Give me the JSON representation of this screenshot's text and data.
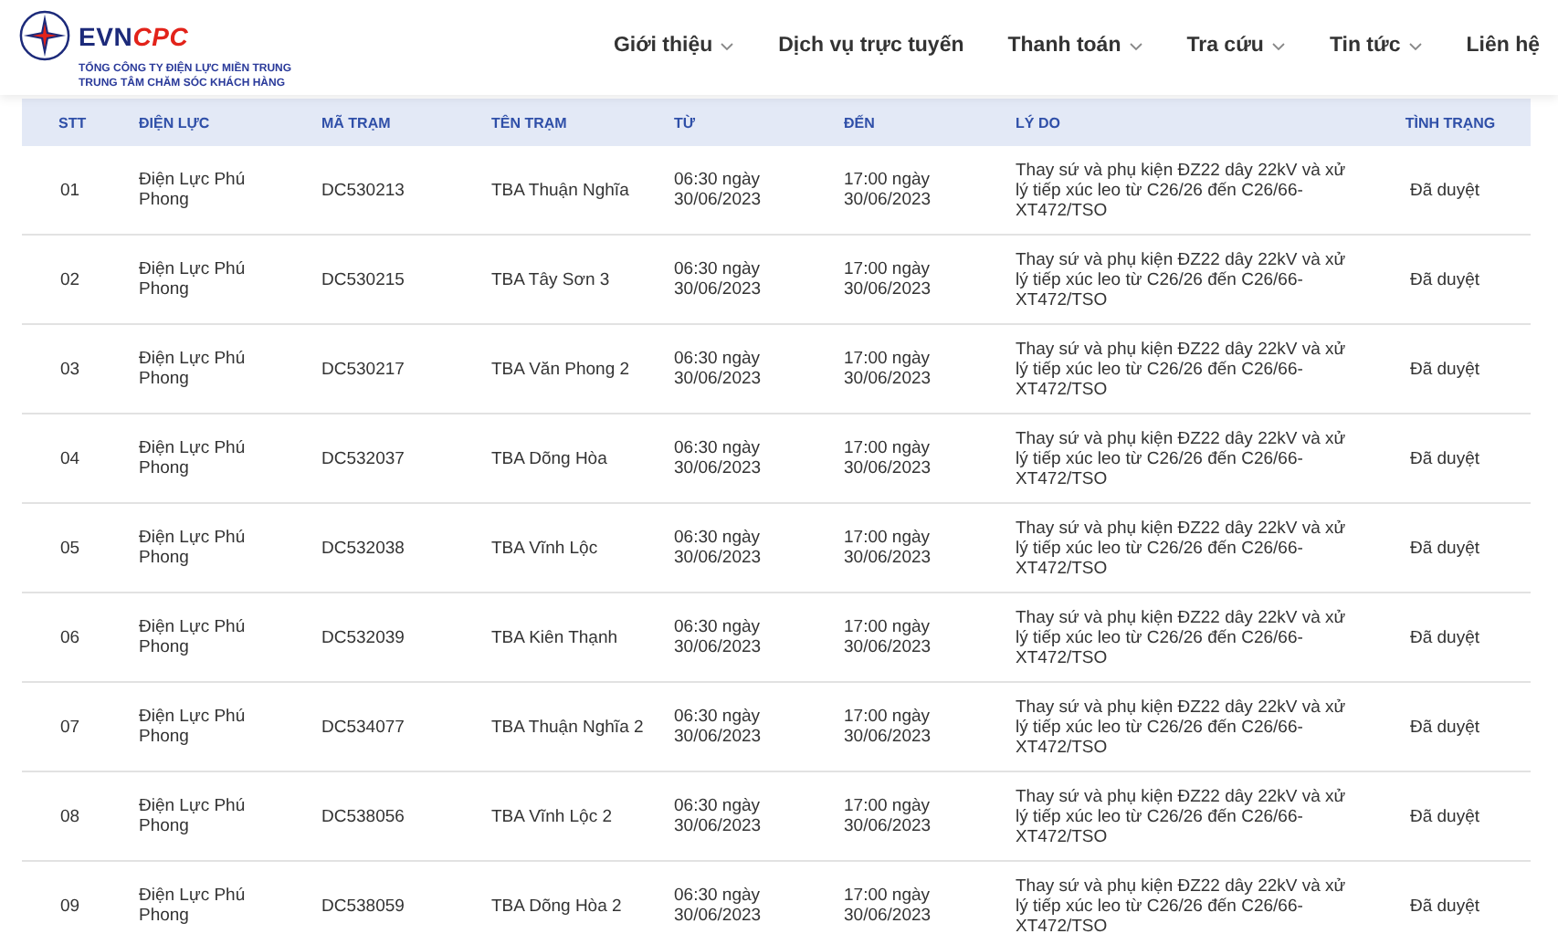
{
  "logo": {
    "brand_main": "EVN",
    "brand_accent": "CPC",
    "line_1": "TỔNG CÔNG TY ĐIỆN LỰC MIỀN TRUNG",
    "line_2": "TRUNG TÂM CHĂM SÓC KHÁCH HÀNG"
  },
  "nav": [
    {
      "label": "Giới thiệu",
      "has_dropdown": true
    },
    {
      "label": "Dịch vụ trực tuyến",
      "has_dropdown": false
    },
    {
      "label": "Thanh toán",
      "has_dropdown": true
    },
    {
      "label": "Tra cứu",
      "has_dropdown": true
    },
    {
      "label": "Tin tức",
      "has_dropdown": true
    },
    {
      "label": "Liên hệ",
      "has_dropdown": false
    }
  ],
  "table": {
    "columns": [
      "STT",
      "ĐIỆN LỰC",
      "MÃ TRẠM",
      "TÊN TRẠM",
      "TỪ",
      "ĐẾN",
      "LÝ DO",
      "TÌNH TRẠNG"
    ],
    "rows": [
      [
        "01",
        "Điện Lực Phú Phong",
        "DC530213",
        "TBA Thuận Nghĩa",
        "06:30 ngày 30/06/2023",
        "17:00 ngày 30/06/2023",
        "Thay sứ và phụ kiện ĐZ22 dây 22kV và xử lý tiếp xúc leo từ C26/26 đến C26/66-XT472/TSO",
        "Đã duyệt"
      ],
      [
        "02",
        "Điện Lực Phú Phong",
        "DC530215",
        "TBA Tây Sơn 3",
        "06:30 ngày 30/06/2023",
        "17:00 ngày 30/06/2023",
        "Thay sứ và phụ kiện ĐZ22 dây 22kV và xử lý tiếp xúc leo từ C26/26 đến C26/66-XT472/TSO",
        "Đã duyệt"
      ],
      [
        "03",
        "Điện Lực Phú Phong",
        "DC530217",
        "TBA Văn Phong 2",
        "06:30 ngày 30/06/2023",
        "17:00 ngày 30/06/2023",
        "Thay sứ và phụ kiện ĐZ22 dây 22kV và xử lý tiếp xúc leo từ C26/26 đến C26/66-XT472/TSO",
        "Đã duyệt"
      ],
      [
        "04",
        "Điện Lực Phú Phong",
        "DC532037",
        "TBA Dõng Hòa",
        "06:30 ngày 30/06/2023",
        "17:00 ngày 30/06/2023",
        "Thay sứ và phụ kiện ĐZ22 dây 22kV và xử lý tiếp xúc leo từ C26/26 đến C26/66-XT472/TSO",
        "Đã duyệt"
      ],
      [
        "05",
        "Điện Lực Phú Phong",
        "DC532038",
        "TBA Vĩnh Lộc",
        "06:30 ngày 30/06/2023",
        "17:00 ngày 30/06/2023",
        "Thay sứ và phụ kiện ĐZ22 dây 22kV và xử lý tiếp xúc leo từ C26/26 đến C26/66-XT472/TSO",
        "Đã duyệt"
      ],
      [
        "06",
        "Điện Lực Phú Phong",
        "DC532039",
        "TBA Kiên Thạnh",
        "06:30 ngày 30/06/2023",
        "17:00 ngày 30/06/2023",
        "Thay sứ và phụ kiện ĐZ22 dây 22kV và xử lý tiếp xúc leo từ C26/26 đến C26/66-XT472/TSO",
        "Đã duyệt"
      ],
      [
        "07",
        "Điện Lực Phú Phong",
        "DC534077",
        "TBA Thuận Nghĩa 2",
        "06:30 ngày 30/06/2023",
        "17:00 ngày 30/06/2023",
        "Thay sứ và phụ kiện ĐZ22 dây 22kV và xử lý tiếp xúc leo từ C26/26 đến C26/66-XT472/TSO",
        "Đã duyệt"
      ],
      [
        "08",
        "Điện Lực Phú Phong",
        "DC538056",
        "TBA Vĩnh Lộc 2",
        "06:30 ngày 30/06/2023",
        "17:00 ngày 30/06/2023",
        "Thay sứ và phụ kiện ĐZ22 dây 22kV và xử lý tiếp xúc leo từ C26/26 đến C26/66-XT472/TSO",
        "Đã duyệt"
      ],
      [
        "09",
        "Điện Lực Phú Phong",
        "DC538059",
        "TBA Dõng Hòa 2",
        "06:30 ngày 30/06/2023",
        "17:00 ngày 30/06/2023",
        "Thay sứ và phụ kiện ĐZ22 dây 22kV và xử lý tiếp xúc leo từ C26/26 đến C26/66-XT472/TSO",
        "Đã duyệt"
      ]
    ]
  }
}
